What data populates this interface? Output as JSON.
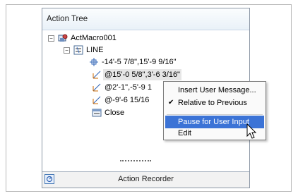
{
  "panel": {
    "title": "Action Tree"
  },
  "tree": {
    "root": {
      "label": "ActMacro001",
      "expander": "−"
    },
    "line": {
      "label": "LINE",
      "expander": "−"
    },
    "points": [
      {
        "label": "-14'-5 7/8\",15'-9 9/16\""
      },
      {
        "label": "@15'-0 5/8\",3'-6 3/16\""
      },
      {
        "label": "@2'-1\",-5'-9 1"
      },
      {
        "label": "@-9'-6 15/16"
      }
    ],
    "close": {
      "label": "Close"
    }
  },
  "context_menu": {
    "items": [
      {
        "label": "Insert User Message...",
        "checked": ""
      },
      {
        "label": "Relative to Previous",
        "checked": "✔"
      },
      {
        "label": "Pause for User Input",
        "checked": ""
      },
      {
        "label": "Edit",
        "checked": ""
      }
    ]
  },
  "status_bar": {
    "label": "Action Recorder"
  },
  "colors": {
    "highlight": "#3b73d6",
    "panel_border": "#8d98a6",
    "title_bg": "#e9f1f8"
  }
}
